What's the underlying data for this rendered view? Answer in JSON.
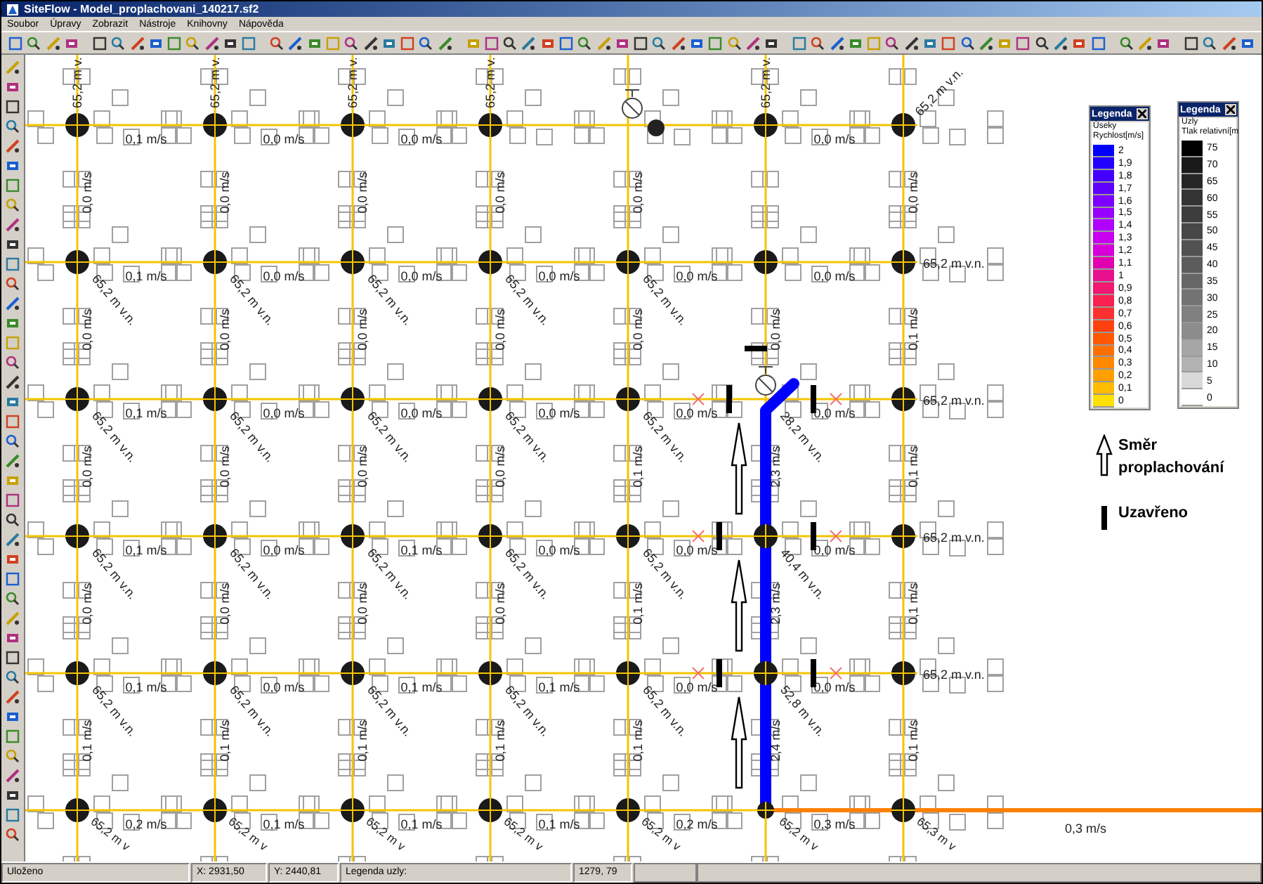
{
  "window": {
    "title": "SiteFlow - Model_proplachovani_140217.sf2"
  },
  "menu": [
    "Soubor",
    "Úpravy",
    "Zobrazit",
    "Nástroje",
    "Knihovny",
    "Nápověda"
  ],
  "map": {
    "horizontal_flows": [
      {
        "s0": "0,1 m/s",
        "s1": "0,0 m/s",
        "s2": "0,0 m/s",
        "s5": "0,0 m/s"
      },
      [
        "0,1 m/s",
        "0,0 m/s",
        "0,0 m/s",
        "0,0 m/s",
        "0,0 m/s",
        "0,0 m/s"
      ],
      [
        "0,1 m/s",
        "0,0 m/s",
        "0,0 m/s",
        "0,0 m/s",
        "0,0 m/s",
        "0,0 m/s"
      ],
      [
        "0,1 m/s",
        "0,0 m/s",
        "0,1 m/s",
        "0,0 m/s",
        "0,0 m/s",
        "0,0 m/s"
      ],
      [
        "0,1 m/s",
        "0,0 m/s",
        "0,1 m/s",
        "0,1 m/s",
        "0,0 m/s",
        "0,0 m/s"
      ],
      [
        "0,2 m/s",
        "0,1 m/s",
        "0,1 m/s",
        "0,1 m/s",
        "0,2 m/s",
        "0,3 m/s"
      ]
    ],
    "vertical_flows": [
      {
        "s0": "0,0 m/s",
        "s1": "0,0 m/s",
        "s2": "0,0 m/s",
        "s3": "0,0 m/s",
        "s4": "0,0 m/s",
        "s6": "0,0 m/s"
      },
      [
        "0,0 m/s",
        "0,0 m/s",
        "0,0 m/s",
        "0,0 m/s",
        "0,0 m/s",
        "0,0 m/s",
        "0,1 m/s"
      ],
      [
        "0,0 m/s",
        "0,0 m/s",
        "0,0 m/s",
        "0,0 m/s",
        "0,1 m/s",
        "2,3 m/s",
        "0,1 m/s"
      ],
      [
        "0,0 m/s",
        "0,0 m/s",
        "0,0 m/s",
        "0,0 m/s",
        "0,1 m/s",
        "2,3 m/s",
        "0,1 m/s"
      ],
      [
        "0,1 m/s",
        "0,1 m/s",
        "0,1 m/s",
        "0,1 m/s",
        "0,1 m/s",
        "2,4 m/s",
        "0,1 m/s"
      ]
    ],
    "top_elevations": {
      "s0": {
        "text": "65,2 m v.",
        "kind": "vertical"
      },
      "s1": {
        "text": "65,2 m v.",
        "kind": "vertical"
      },
      "s2": {
        "text": "65,2 m v.",
        "kind": "vertical"
      },
      "s3": {
        "text": "65,2 m v.",
        "kind": "vertical"
      },
      "s5": {
        "text": "65,2 m v.",
        "kind": "vertical"
      },
      "s6": {
        "text": "65,2 m v.n.",
        "kind": "diagonal"
      }
    },
    "node_elevations": [
      [
        "65,2 m v.n.",
        "65,2 m v.n.",
        "65,2 m v.n.",
        "65,2 m v.n.",
        "65,2 m v.n."
      ],
      [
        "65,2 m v.n.",
        "65,2 m v.n.",
        "65,2 m v.n.",
        "65,2 m v.n.",
        "65,2 m v.n.",
        "28,2 m v.n."
      ],
      [
        "65,2 m v.n.",
        "65,2 m v.n.",
        "65,2 m v.n.",
        "65,2 m v.n.",
        "65,2 m v.n.",
        "40,4 m v.n."
      ],
      [
        "65,2 m v.n.",
        "65,2 m v.n.",
        "65,2 m v.n.",
        "65,2 m v.n.",
        "65,2 m v.n.",
        "52,8 m v.n."
      ]
    ],
    "bottom_elevations": [
      "65,2 m v",
      "65,2 m v",
      "65,2 m v",
      "65,2 m v",
      "65,2 m v",
      "65,2 m v",
      "65,3 m v"
    ],
    "right_elevations": [
      "65,2 m v.n.",
      "65,2 m v.n.",
      "65,2 m v.n.",
      "65,2 m v.n."
    ],
    "outflow_label": "0,3 m/s"
  },
  "annotation": {
    "direction_label": "Směr proplachování",
    "closed_label": "Uzavřeno"
  },
  "legends": [
    {
      "title": "Legenda",
      "subtitle": "Úseky",
      "quantity": "Rychlost[m/s]",
      "entries": [
        {
          "label": "2",
          "color": "#0000ff"
        },
        {
          "label": "1,9",
          "color": "#2200ff"
        },
        {
          "label": "1,8",
          "color": "#4400ff"
        },
        {
          "label": "1,7",
          "color": "#6000ff"
        },
        {
          "label": "1,6",
          "color": "#7c00ff"
        },
        {
          "label": "1,5",
          "color": "#9600ff"
        },
        {
          "label": "1,4",
          "color": "#b000ff"
        },
        {
          "label": "1,3",
          "color": "#c800f0"
        },
        {
          "label": "1,2",
          "color": "#d800d8"
        },
        {
          "label": "1,1",
          "color": "#e000b0"
        },
        {
          "label": "1",
          "color": "#e8108f"
        },
        {
          "label": "0,9",
          "color": "#f01870"
        },
        {
          "label": "0,8",
          "color": "#f82050"
        },
        {
          "label": "0,7",
          "color": "#ff3030"
        },
        {
          "label": "0,6",
          "color": "#ff4010"
        },
        {
          "label": "0,5",
          "color": "#ff5800"
        },
        {
          "label": "0,4",
          "color": "#ff7000"
        },
        {
          "label": "0,3",
          "color": "#ff8800"
        },
        {
          "label": "0,2",
          "color": "#ffa000"
        },
        {
          "label": "0,1",
          "color": "#ffbb00"
        },
        {
          "label": "0",
          "color": "#ffe000"
        }
      ]
    },
    {
      "title": "Legenda",
      "subtitle": "Uzly",
      "quantity": "Tlak relativní[m",
      "entries": [
        {
          "label": "75",
          "color": "#000000"
        },
        {
          "label": "70",
          "color": "#1a1a1a"
        },
        {
          "label": "65",
          "color": "#262626"
        },
        {
          "label": "60",
          "color": "#333333"
        },
        {
          "label": "55",
          "color": "#3d3d3d"
        },
        {
          "label": "50",
          "color": "#474747"
        },
        {
          "label": "45",
          "color": "#525252"
        },
        {
          "label": "40",
          "color": "#5c5c5c"
        },
        {
          "label": "35",
          "color": "#666666"
        },
        {
          "label": "30",
          "color": "#737373"
        },
        {
          "label": "25",
          "color": "#808080"
        },
        {
          "label": "20",
          "color": "#8c8c8c"
        },
        {
          "label": "15",
          "color": "#a6a6a6"
        },
        {
          "label": "10",
          "color": "#b3b3b3"
        },
        {
          "label": "5",
          "color": "#d9d9d9"
        },
        {
          "label": "0",
          "color": "#ffffff"
        }
      ]
    }
  ],
  "status_bar": [
    "Uloženo",
    "X: 2931,50",
    "Y: 2440,81",
    "Legenda uzly:",
    "1279, 79"
  ]
}
